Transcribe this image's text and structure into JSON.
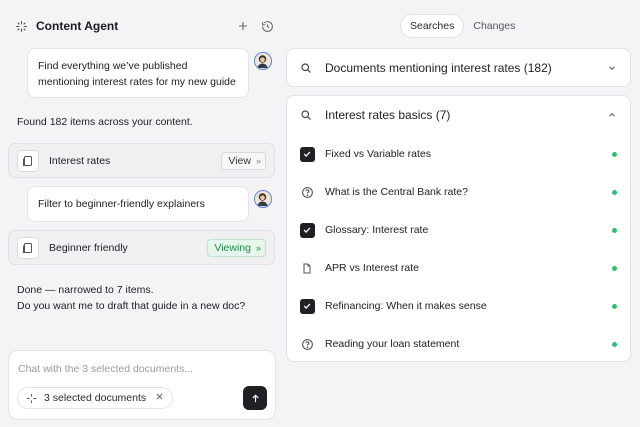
{
  "agent": {
    "title": "Content Agent",
    "icons": {
      "brand": "sparkle-icon",
      "add": "plus-icon",
      "history": "history-icon"
    }
  },
  "messages": {
    "user1": "Find everything we’ve published mentioning interest rates for my new guide",
    "bot1": "Found 182 items across your content.",
    "card1": {
      "label": "Interest rates",
      "action": "View",
      "chevron": "»"
    },
    "user2": "Filter to beginner-friendly explainers",
    "card2": {
      "label": "Beginner friendly",
      "action": "Viewing",
      "chevron": "»"
    },
    "bot2_line1": "Done — narrowed to 7 items.",
    "bot2_line2": "Do you want me to draft that guide in a new doc?"
  },
  "chat": {
    "placeholder": "Chat with the 3 selected documents...",
    "chip_label": "3 selected documents"
  },
  "tabs": [
    {
      "label": "Searches",
      "active": true
    },
    {
      "label": "Changes",
      "active": false
    }
  ],
  "searches": {
    "collapsed": {
      "title": "Documents mentioning interest rates (182)"
    },
    "expanded": {
      "title": "Interest rates basics (7)",
      "items": [
        {
          "title": "Fixed vs Variable rates",
          "icon": "checkbox-checked-icon",
          "selected": true
        },
        {
          "title": "What is the Central Bank rate?",
          "icon": "question-circle-icon",
          "selected": false
        },
        {
          "title": "Glossary: Interest rate",
          "icon": "checkbox-checked-icon",
          "selected": true
        },
        {
          "title": "APR vs Interest rate",
          "icon": "document-icon",
          "selected": false
        },
        {
          "title": "Refinancing: When it makes sense",
          "icon": "checkbox-checked-icon",
          "selected": true
        },
        {
          "title": "Reading your loan statement",
          "icon": "question-circle-icon",
          "selected": false
        }
      ]
    }
  },
  "colors": {
    "accent_dark": "#1f2024",
    "status_green": "#2fbf71",
    "viewing_bg": "#e7f6ec",
    "viewing_text": "#1d8a47"
  }
}
